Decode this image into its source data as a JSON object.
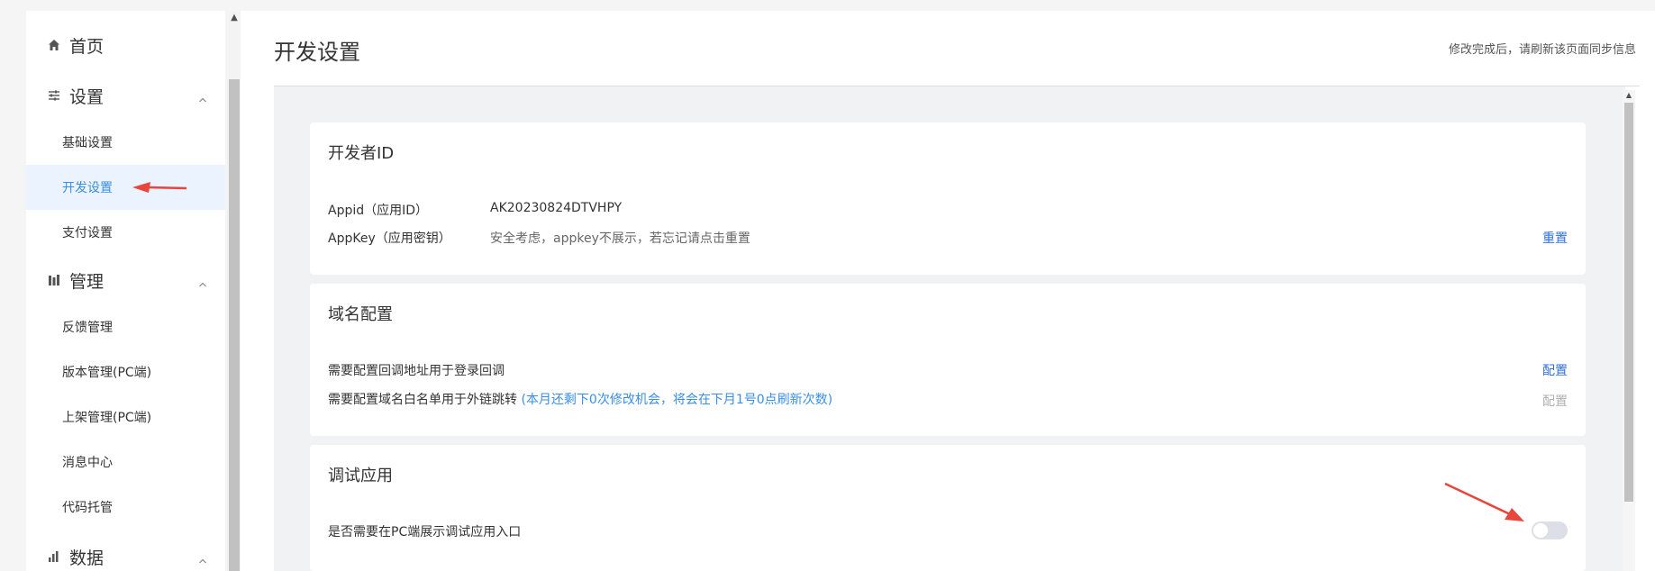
{
  "sidebar": {
    "home": {
      "label": "首页",
      "icon": "home-icon"
    },
    "groups": [
      {
        "label": "设置",
        "icon": "sliders-icon",
        "items": [
          {
            "label": "基础设置"
          },
          {
            "label": "开发设置",
            "active": true
          },
          {
            "label": "支付设置"
          }
        ]
      },
      {
        "label": "管理",
        "icon": "bar-chart-icon",
        "items": [
          {
            "label": "反馈管理"
          },
          {
            "label": "版本管理(PC端)"
          },
          {
            "label": "上架管理(PC端)"
          },
          {
            "label": "消息中心"
          },
          {
            "label": "代码托管"
          }
        ]
      },
      {
        "label": "数据",
        "icon": "stats-icon"
      }
    ]
  },
  "header": {
    "title": "开发设置",
    "hint": "修改完成后，请刷新该页面同步信息"
  },
  "cards": {
    "developer": {
      "title": "开发者ID",
      "appid_label": "Appid（应用ID）",
      "appid_value": "AK20230824DTVHPY",
      "appkey_label": "AppKey（应用密钥）",
      "appkey_value": "安全考虑，appkey不展示，若忘记请点击重置",
      "reset_label": "重置"
    },
    "domain": {
      "title": "域名配置",
      "row1_label": "需要配置回调地址用于登录回调",
      "row1_action": "配置",
      "row2_label": "需要配置域名白名单用于外链跳转",
      "row2_note": "(本月还剩下0次修改机会，将会在下月1号0点刷新次数)",
      "row2_action": "配置"
    },
    "debug": {
      "title": "调试应用",
      "row_label": "是否需要在PC端展示调试应用入口",
      "toggle_on": false
    }
  },
  "colors": {
    "accent": "#3a8ee6",
    "link": "#2f6fe0",
    "annotation_arrow": "#e8453c",
    "active_bg": "#eaf3fe"
  }
}
